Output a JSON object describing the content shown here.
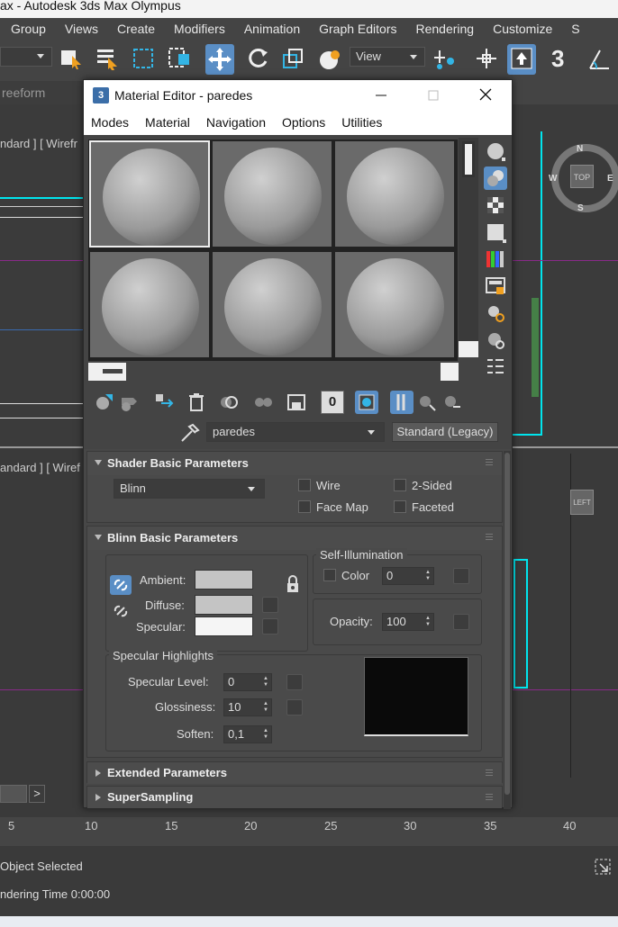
{
  "app": {
    "title": "ax - Autodesk 3ds Max Olympus"
  },
  "menu": [
    "Group",
    "Views",
    "Create",
    "Modifiers",
    "Animation",
    "Graph Editors",
    "Rendering",
    "Customize",
    "S"
  ],
  "toolbar": {
    "view_dropdown": "View",
    "snap_label": "3"
  },
  "ribbon": {
    "label": "reeform"
  },
  "viewports": {
    "top_left_label": "ndard ] [ Wirefr",
    "bottom_left_label": "andard ] [ Wiref",
    "viewcube_top": "TOP",
    "viewcube_left": "LEFT",
    "compass": {
      "n": "N",
      "s": "S",
      "e": "E",
      "w": "W"
    }
  },
  "timeline": {
    "ticks": [
      "5",
      "10",
      "15",
      "20",
      "25",
      "30",
      "35",
      "40"
    ],
    "next_btn": ">"
  },
  "status": {
    "selection": "Object Selected",
    "render_time": "ndering Time  0:00:00"
  },
  "material_editor": {
    "title": "Material Editor - paredes",
    "window_icon": "3",
    "menu": [
      "Modes",
      "Material",
      "Navigation",
      "Options",
      "Utilities"
    ],
    "material_name": "paredes",
    "material_type": "Standard (Legacy)",
    "shader_rollout": {
      "title": "Shader Basic Parameters",
      "shader": "Blinn",
      "wire": "Wire",
      "two_sided": "2-Sided",
      "face_map": "Face Map",
      "faceted": "Faceted"
    },
    "blinn_rollout": {
      "title": "Blinn Basic Parameters",
      "ambient_label": "Ambient:",
      "diffuse_label": "Diffuse:",
      "specular_label": "Specular:",
      "ambient_color": "#c4c4c4",
      "diffuse_color": "#c4c4c4",
      "specular_color": "#f5f5f5",
      "self_illum_title": "Self-Illumination",
      "color_label": "Color",
      "color_value": "0",
      "opacity_label": "Opacity:",
      "opacity_value": "100",
      "spec_title": "Specular Highlights",
      "spec_level_label": "Specular Level:",
      "spec_level": "0",
      "gloss_label": "Glossiness:",
      "gloss": "10",
      "soften_label": "Soften:",
      "soften": "0,1"
    },
    "extended_rollout": "Extended Parameters",
    "supersampling_rollout": "SuperSampling",
    "bottom_toolbar_id": "0"
  }
}
